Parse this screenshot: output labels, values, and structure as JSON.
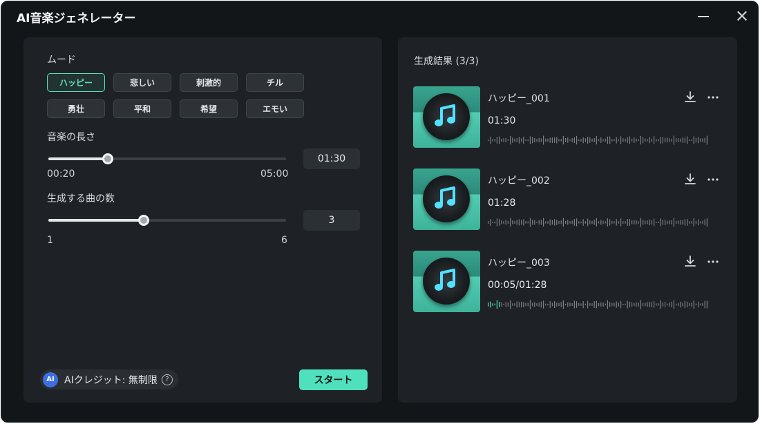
{
  "window": {
    "title": "AI音楽ジェネレーター"
  },
  "left_panel": {
    "mood_label": "ムード",
    "moods": [
      {
        "label": "ハッピー",
        "active": true
      },
      {
        "label": "悲しい",
        "active": false
      },
      {
        "label": "刺激的",
        "active": false
      },
      {
        "label": "チル",
        "active": false
      },
      {
        "label": "勇壮",
        "active": false
      },
      {
        "label": "平和",
        "active": false
      },
      {
        "label": "希望",
        "active": false
      },
      {
        "label": "エモい",
        "active": false
      }
    ],
    "length": {
      "label": "音楽の長さ",
      "min_label": "00:20",
      "max_label": "05:00",
      "value": "01:30",
      "fraction": 0.25
    },
    "count": {
      "label": "生成する曲の数",
      "min_label": "1",
      "max_label": "6",
      "value": "3",
      "fraction": 0.4
    },
    "credits_text": "AIクレジット: 無制限",
    "ai_badge": "AI",
    "help_glyph": "?",
    "start_label": "スタート"
  },
  "right_panel": {
    "title": "生成結果 (3/3)",
    "results": [
      {
        "name": "ハッピー_001",
        "time": "01:30",
        "progress": 0
      },
      {
        "name": "ハッピー_002",
        "time": "01:28",
        "progress": 0
      },
      {
        "name": "ハッピー_003",
        "time": "00:05/01:28",
        "progress": 0.06
      }
    ]
  },
  "icons": {
    "minimize": "minimize-icon",
    "close": "close-icon",
    "download": "download-icon",
    "more": "more-icon",
    "music_note": "music-note-icon",
    "help": "help-icon"
  },
  "colors": {
    "accent": "#4fe0bd",
    "active_text": "#5ce4c2",
    "window_bg": "#131619",
    "panel_bg": "#1e2226",
    "wave_idle": "#7c8187",
    "wave_played": "#4fe0bd"
  }
}
